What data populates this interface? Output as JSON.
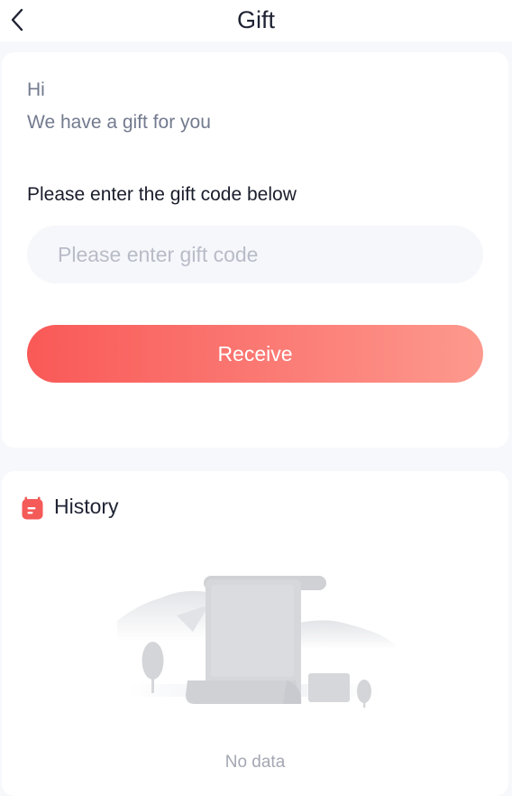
{
  "header": {
    "title": "Gift"
  },
  "gift": {
    "greeting": "Hi",
    "message": "We have a gift for you",
    "instruction": "Please enter the gift code below",
    "code_value": "",
    "code_placeholder": "Please enter gift code",
    "receive_label": "Receive",
    "accent_start": "#f95957",
    "accent_end": "#fd998e"
  },
  "history": {
    "title": "History",
    "icon": "calendar-icon",
    "empty_icon": "empty-scroll-illustration",
    "empty_text": "No data"
  }
}
